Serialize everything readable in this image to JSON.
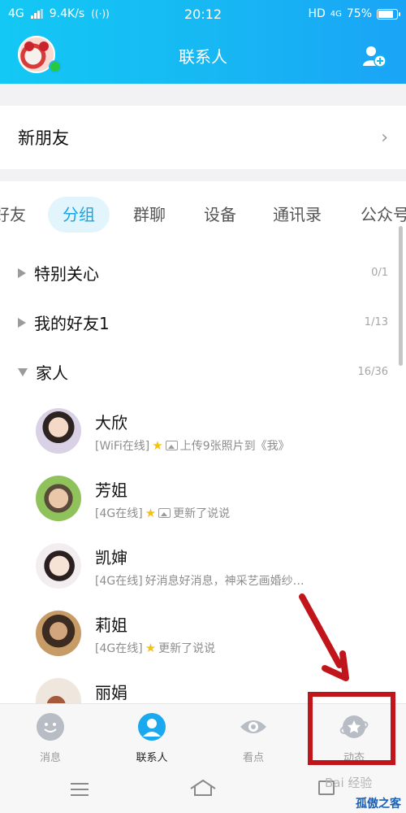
{
  "status_bar": {
    "network": "4G",
    "speed": "9.4K/s",
    "time": "20:12",
    "hd_label": "HD",
    "network_right": "4G",
    "battery": "75%"
  },
  "header": {
    "title": "联系人"
  },
  "new_friend": {
    "label": "新朋友",
    "chevron": "›"
  },
  "tabs": [
    {
      "label": "好友",
      "active": false
    },
    {
      "label": "分组",
      "active": true
    },
    {
      "label": "群聊",
      "active": false
    },
    {
      "label": "设备",
      "active": false
    },
    {
      "label": "通讯录",
      "active": false
    },
    {
      "label": "公众号",
      "active": false
    }
  ],
  "groups": [
    {
      "name": "特别关心",
      "count": "0/1",
      "expanded": false
    },
    {
      "name": "我的好友1",
      "count": "1/13",
      "expanded": false
    },
    {
      "name": "家人",
      "count": "16/36",
      "expanded": true
    }
  ],
  "contacts": [
    {
      "name": "大欣",
      "network": "[WiFi在线]",
      "activity": "上传9张照片到《我》",
      "star": true,
      "photo": true
    },
    {
      "name": "芳姐",
      "network": "[4G在线]",
      "activity": "更新了说说",
      "star": true,
      "photo": true
    },
    {
      "name": "凯婶",
      "network": "[4G在线]",
      "activity": "好消息好消息，神采艺画婚纱…",
      "star": false,
      "photo": false
    },
    {
      "name": "莉姐",
      "network": "[4G在线]",
      "activity": "更新了说说",
      "star": true,
      "photo": false
    },
    {
      "name": "丽娟",
      "network": "",
      "activity": "",
      "star": false,
      "photo": false
    }
  ],
  "bottom_nav": [
    {
      "label": "消息",
      "icon": "message-icon",
      "active": false
    },
    {
      "label": "联系人",
      "icon": "contacts-icon",
      "active": true
    },
    {
      "label": "看点",
      "icon": "eye-icon",
      "active": false
    },
    {
      "label": "动态",
      "icon": "planet-star-icon",
      "active": false
    }
  ],
  "watermark": "孤傲之客",
  "baidu_mark": "Bai 经验",
  "colors": {
    "header_start": "#13c8f4",
    "header_end": "#1aa4f6",
    "active_tab_text": "#15a5e6",
    "active_tab_bg": "#e3f5fc",
    "annotation_red": "#c0161b",
    "online_green": "#27c93f"
  }
}
